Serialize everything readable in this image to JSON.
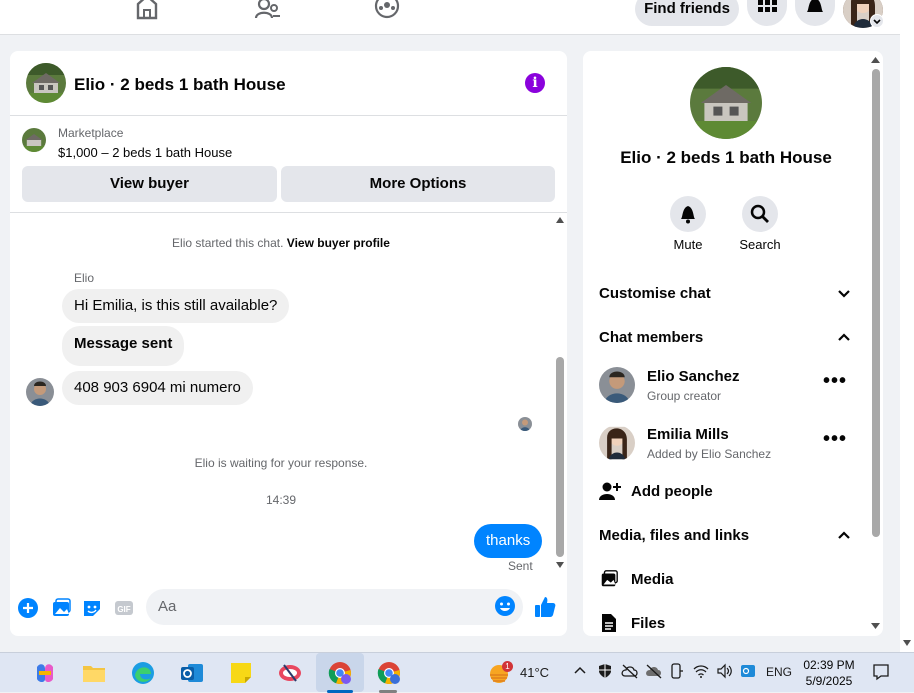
{
  "topnav": {
    "find_friends": "Find friends"
  },
  "chat": {
    "title": "Elio · 2 beds 1 bath House",
    "marketplace_label": "Marketplace",
    "listing": "$1,000 – 2 beds 1 bath House",
    "view_buyer": "View buyer",
    "more_options": "More Options",
    "started_prefix": "Elio started this chat.",
    "view_buyer_profile": "View buyer profile",
    "sender_name": "Elio",
    "messages": [
      {
        "text": "Hi Emilia, is this still available?"
      },
      {
        "text": "Message sent"
      },
      {
        "text": "408 903 6904 mi numero"
      }
    ],
    "waiting": "Elio is waiting for your response.",
    "time": "14:39",
    "my_message": "thanks",
    "sent_status": "Sent",
    "input_placeholder": "Aa"
  },
  "info": {
    "title": "Elio · 2 beds 1 bath House",
    "mute": "Mute",
    "search": "Search",
    "customise_chat": "Customise chat",
    "chat_members": "Chat members",
    "members": [
      {
        "name": "Elio Sanchez",
        "role": "Group creator"
      },
      {
        "name": "Emilia Mills",
        "role": "Added by Elio Sanchez"
      }
    ],
    "add_people": "Add people",
    "media_section": "Media, files and links",
    "media": "Media",
    "files": "Files"
  },
  "taskbar": {
    "temperature": "41°C",
    "weather_badge": "1",
    "language": "ENG",
    "time": "02:39 PM",
    "date": "5/9/2025"
  },
  "colors": {
    "accent_blue": "#0084ff",
    "info_purple": "#8a02dc"
  }
}
